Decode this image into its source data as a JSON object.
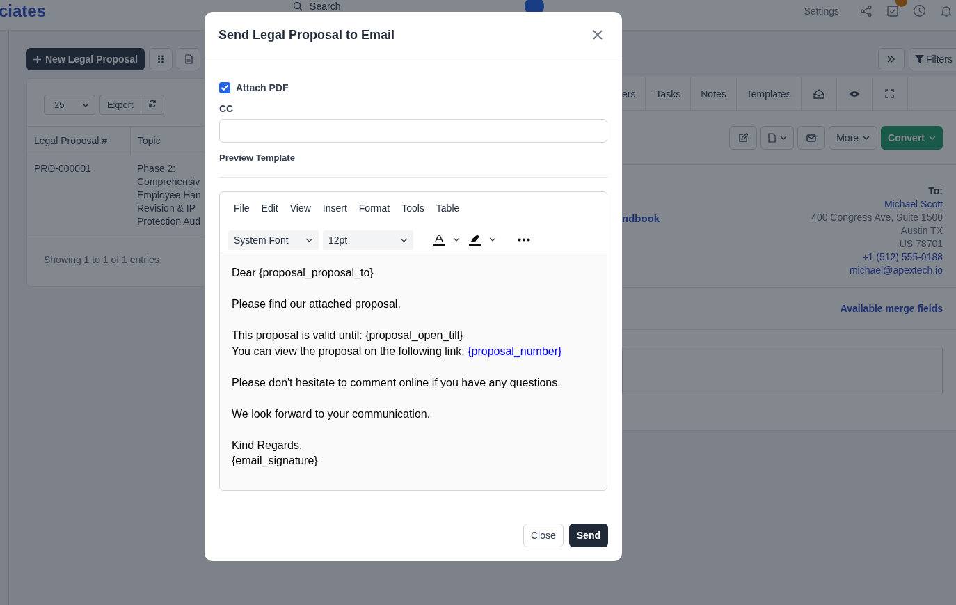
{
  "app": {
    "logo": "ciates",
    "search": {
      "placeholder": "Search"
    },
    "settings_link": "Settings"
  },
  "list": {
    "new_button": "New Legal Proposal",
    "page_size": "25",
    "export": "Export",
    "columns": [
      "Legal Proposal #",
      "Topic"
    ],
    "rows": [
      {
        "number": "PRO-000001",
        "topic": [
          "Phase 2:",
          "Comprehensiv",
          "Employee Han",
          "Revision & IP",
          "Protection Aud"
        ]
      }
    ],
    "footer": "Showing 1 to 1 of 1 entries"
  },
  "detail": {
    "filters_button": "Filters",
    "tabs": [
      {
        "label": "ers",
        "selected": false
      },
      {
        "label": "Tasks",
        "selected": false
      },
      {
        "label": "Notes",
        "selected": false
      },
      {
        "label": "Templates",
        "selected": false
      }
    ],
    "more_button": "More",
    "convert_button": "Convert",
    "title_fragment": "ndbook",
    "to_label": "To:",
    "client_name": "Michael Scott",
    "address": [
      "400 Congress Ave, Suite 1500",
      "Austin TX",
      "US 78701"
    ],
    "phone": "+1 (512) 555-0188",
    "email": "michael@apextech.io",
    "merge_fields_link": "Available merge fields"
  },
  "modal": {
    "title": "Send Legal Proposal to Email",
    "attach_pdf": {
      "label": "Attach PDF",
      "checked": true
    },
    "cc": {
      "label": "CC"
    },
    "preview_label": "Preview Template",
    "editor": {
      "menu": [
        "File",
        "Edit",
        "View",
        "Insert",
        "Format",
        "Tools",
        "Table"
      ],
      "font": "System Font",
      "size": "12pt",
      "paragraphs": [
        {
          "lines": [
            {
              "text": "Dear {proposal_proposal_to}"
            }
          ]
        },
        {
          "lines": [
            {
              "text": "Please find our attached proposal."
            }
          ]
        },
        {
          "lines": [
            {
              "text": "This proposal is valid until: {proposal_open_till}"
            },
            {
              "text": "You can view the proposal on the following link: ",
              "link": "{proposal_number}"
            }
          ]
        },
        {
          "lines": [
            {
              "text": "Please don't hesitate to comment online if you have any questions."
            }
          ]
        },
        {
          "lines": [
            {
              "text": "We look forward to your communication."
            }
          ]
        },
        {
          "lines": [
            {
              "text": "Kind Regards,"
            },
            {
              "text": "{email_signature}"
            }
          ]
        }
      ]
    },
    "close_button": "Close",
    "send_button": "Send"
  }
}
